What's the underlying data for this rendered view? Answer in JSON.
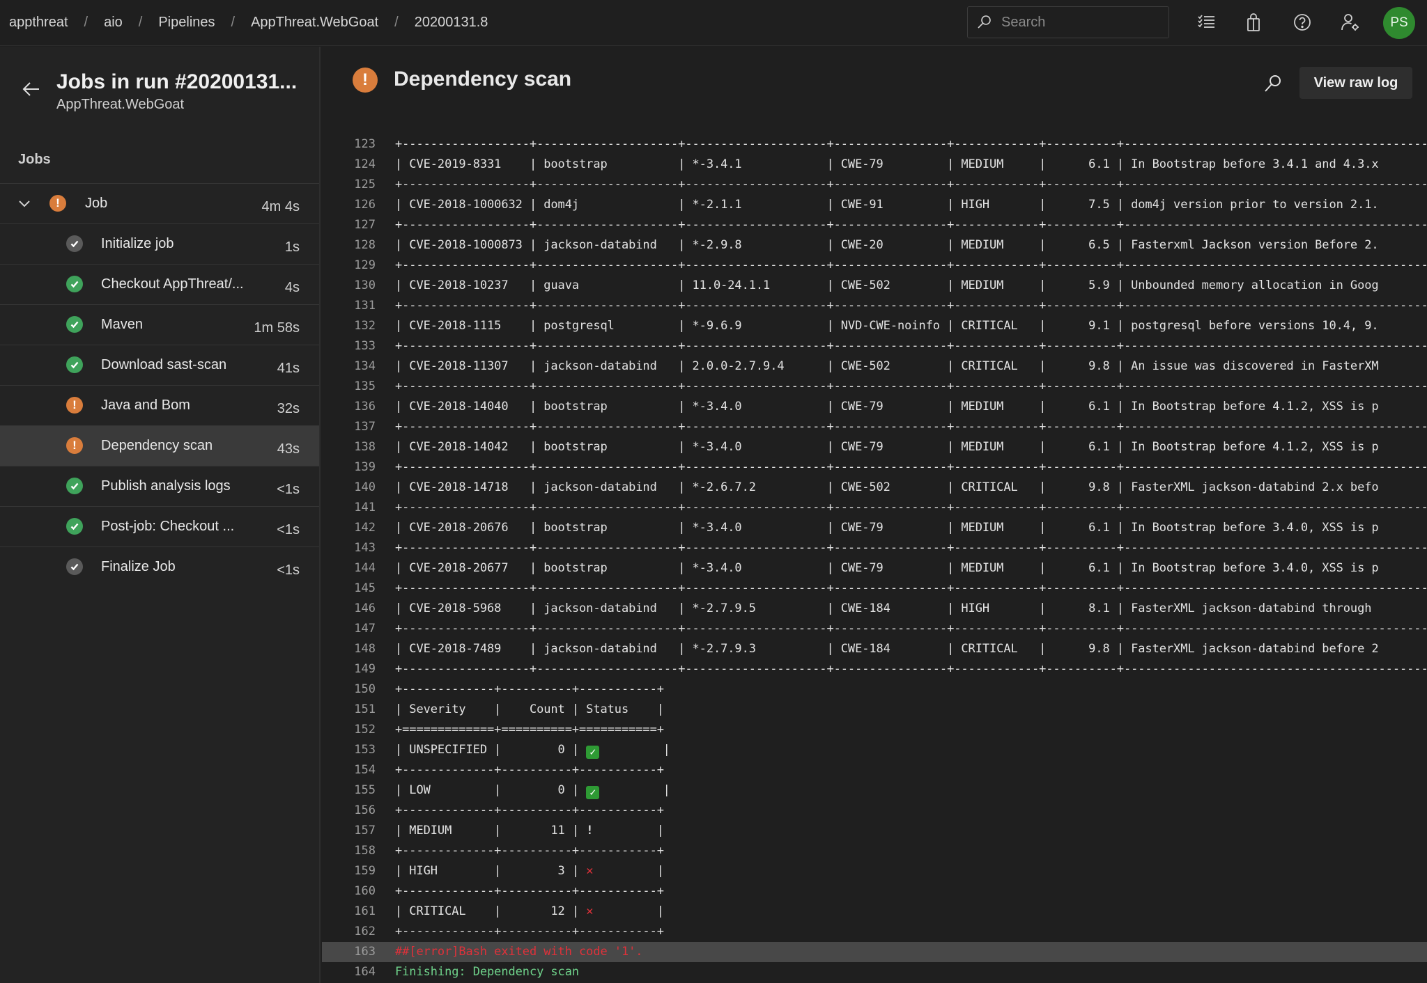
{
  "breadcrumb": [
    "appthreat",
    "aio",
    "Pipelines",
    "AppThreat.WebGoat",
    "20200131.8"
  ],
  "breadcrumb_separator": "/",
  "search": {
    "placeholder": "Search",
    "value": ""
  },
  "topbar_icons": [
    "work-items-icon",
    "marketplace-bag-icon",
    "help-icon",
    "user-settings-icon"
  ],
  "avatar": {
    "initials": "PS",
    "color": "#2f8a2f"
  },
  "sidebar": {
    "title": "Jobs in run #20200131...",
    "subtitle": "AppThreat.WebGoat",
    "section_label": "Jobs",
    "job": {
      "label": "Job",
      "duration": "4m 4s",
      "status": "warning"
    },
    "steps": [
      {
        "label": "Initialize job",
        "duration": "1s",
        "status": "done"
      },
      {
        "label": "Checkout AppThreat/...",
        "duration": "4s",
        "status": "success"
      },
      {
        "label": "Maven",
        "duration": "1m 58s",
        "status": "success"
      },
      {
        "label": "Download sast-scan",
        "duration": "41s",
        "status": "success"
      },
      {
        "label": "Java and Bom",
        "duration": "32s",
        "status": "warning"
      },
      {
        "label": "Dependency scan",
        "duration": "43s",
        "status": "warning",
        "selected": true
      },
      {
        "label": "Publish analysis logs",
        "duration": "<1s",
        "status": "success"
      },
      {
        "label": "Post-job: Checkout ...",
        "duration": "<1s",
        "status": "success"
      },
      {
        "label": "Finalize Job",
        "duration": "<1s",
        "status": "done"
      }
    ]
  },
  "main": {
    "title": "Dependency scan",
    "status": "warning",
    "view_raw_log_label": "View raw log"
  },
  "colors": {
    "warning": "#d97d3c",
    "success": "#3fa35b",
    "done": "#5a5a5a",
    "error_text": "#e0313a",
    "finish_text": "#6fd38b"
  },
  "vulnerabilities": [
    {
      "line": 124,
      "id": "CVE-2019-8331",
      "package": "bootstrap",
      "version": "*-3.4.1",
      "cwe": "CWE-79",
      "severity": "MEDIUM",
      "score": "6.1",
      "description": "In Bootstrap before 3.4.1 and 4.3.x"
    },
    {
      "line": 126,
      "id": "CVE-2018-1000632",
      "package": "dom4j",
      "version": "*-2.1.1",
      "cwe": "CWE-91",
      "severity": "HIGH",
      "score": "7.5",
      "description": "dom4j version prior to version 2.1."
    },
    {
      "line": 128,
      "id": "CVE-2018-1000873",
      "package": "jackson-databind",
      "version": "*-2.9.8",
      "cwe": "CWE-20",
      "severity": "MEDIUM",
      "score": "6.5",
      "description": "Fasterxml Jackson version Before 2."
    },
    {
      "line": 130,
      "id": "CVE-2018-10237",
      "package": "guava",
      "version": "11.0-24.1.1",
      "cwe": "CWE-502",
      "severity": "MEDIUM",
      "score": "5.9",
      "description": "Unbounded memory allocation in Goog"
    },
    {
      "line": 132,
      "id": "CVE-2018-1115",
      "package": "postgresql",
      "version": "*-9.6.9",
      "cwe": "NVD-CWE-noinfo",
      "severity": "CRITICAL",
      "score": "9.1",
      "description": "postgresql before versions 10.4, 9."
    },
    {
      "line": 134,
      "id": "CVE-2018-11307",
      "package": "jackson-databind",
      "version": "2.0.0-2.7.9.4",
      "cwe": "CWE-502",
      "severity": "CRITICAL",
      "score": "9.8",
      "description": "An issue was discovered in FasterXM"
    },
    {
      "line": 136,
      "id": "CVE-2018-14040",
      "package": "bootstrap",
      "version": "*-3.4.0",
      "cwe": "CWE-79",
      "severity": "MEDIUM",
      "score": "6.1",
      "description": "In Bootstrap before 4.1.2, XSS is p"
    },
    {
      "line": 138,
      "id": "CVE-2018-14042",
      "package": "bootstrap",
      "version": "*-3.4.0",
      "cwe": "CWE-79",
      "severity": "MEDIUM",
      "score": "6.1",
      "description": "In Bootstrap before 4.1.2, XSS is p"
    },
    {
      "line": 140,
      "id": "CVE-2018-14718",
      "package": "jackson-databind",
      "version": "*-2.6.7.2",
      "cwe": "CWE-502",
      "severity": "CRITICAL",
      "score": "9.8",
      "description": "FasterXML jackson-databind 2.x befo"
    },
    {
      "line": 142,
      "id": "CVE-2018-20676",
      "package": "bootstrap",
      "version": "*-3.4.0",
      "cwe": "CWE-79",
      "severity": "MEDIUM",
      "score": "6.1",
      "description": "In Bootstrap before 3.4.0, XSS is p"
    },
    {
      "line": 144,
      "id": "CVE-2018-20677",
      "package": "bootstrap",
      "version": "*-3.4.0",
      "cwe": "CWE-79",
      "severity": "MEDIUM",
      "score": "6.1",
      "description": "In Bootstrap before 3.4.0, XSS is p"
    },
    {
      "line": 146,
      "id": "CVE-2018-5968",
      "package": "jackson-databind",
      "version": "*-2.7.9.5",
      "cwe": "CWE-184",
      "severity": "HIGH",
      "score": "8.1",
      "description": "FasterXML jackson-databind through "
    },
    {
      "line": 148,
      "id": "CVE-2018-7489",
      "package": "jackson-databind",
      "version": "*-2.7.9.3",
      "cwe": "CWE-184",
      "severity": "CRITICAL",
      "score": "9.8",
      "description": "FasterXML jackson-databind before 2"
    }
  ],
  "first_line_number": 123,
  "summary": {
    "headers": [
      "Severity",
      "Count",
      "Status"
    ],
    "rows": [
      {
        "severity": "UNSPECIFIED",
        "count": "0",
        "status": "pass"
      },
      {
        "severity": "LOW",
        "count": "0",
        "status": "pass"
      },
      {
        "severity": "MEDIUM",
        "count": "11",
        "status": "warn"
      },
      {
        "severity": "HIGH",
        "count": "3",
        "status": "fail"
      },
      {
        "severity": "CRITICAL",
        "count": "12",
        "status": "fail"
      }
    ]
  },
  "status_glyphs": {
    "pass": "✓",
    "warn": "!",
    "fail": "✕"
  },
  "error_line": {
    "line": 163,
    "text": "##[error]Bash exited with code '1'."
  },
  "finish_line": {
    "line": 164,
    "text": "Finishing: Dependency scan"
  }
}
